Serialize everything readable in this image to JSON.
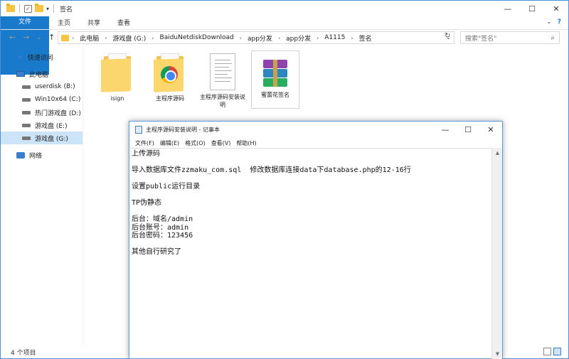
{
  "explorer": {
    "title": "签名",
    "ribbon_tabs": [
      "文件",
      "主页",
      "共享",
      "查看"
    ],
    "nav": {
      "back": "←",
      "forward": "→",
      "dropdown": "⌄",
      "up": "↑"
    },
    "breadcrumb": [
      "此电脑",
      "游戏盘 (G:)",
      "BaiduNetdiskDownload",
      "app分发",
      "app分发",
      "A1115",
      "签名"
    ],
    "search_placeholder": "搜索\"签名\"",
    "sidebar": {
      "quick_access": "快速访问",
      "this_pc": "此电脑",
      "drives": [
        {
          "label": "userdisk (B:)",
          "icon": "drive-icon"
        },
        {
          "label": "Win10x64 (C:)",
          "icon": "drive-icon"
        },
        {
          "label": "热门游戏盘 (D:)",
          "icon": "drive-icon"
        },
        {
          "label": "游戏盘 (E:)",
          "icon": "drive-icon"
        },
        {
          "label": "游戏盘 (G:)",
          "icon": "drive-icon",
          "selected": true
        }
      ],
      "network": "网络"
    },
    "files": [
      {
        "name": "isign",
        "type": "folder"
      },
      {
        "name": "主程序源码",
        "type": "folder-chrome"
      },
      {
        "name": "主程序源码安装说明",
        "type": "text-document"
      },
      {
        "name": "蜜蕾花签名",
        "type": "rar-archive"
      }
    ],
    "status": "4 个项目"
  },
  "notepad": {
    "title": "主程序源码安装说明 - 记事本",
    "menu": [
      "文件(F)",
      "编辑(E)",
      "格式(O)",
      "查看(V)",
      "帮助(H)"
    ],
    "content": "上传源码\n\n导入数据库文件zzmaku_com.sql  修改数据库连接data下database.php的12-16行\n\n设置public运行目录\n\nTP伪静态\n\n后台：域名/admin\n后台账号：admin\n后台密码：123456\n\n其他自行研究了"
  },
  "colors": {
    "accent": "#1979ca",
    "selection": "#cce4f7",
    "folder": "#f5c542"
  }
}
